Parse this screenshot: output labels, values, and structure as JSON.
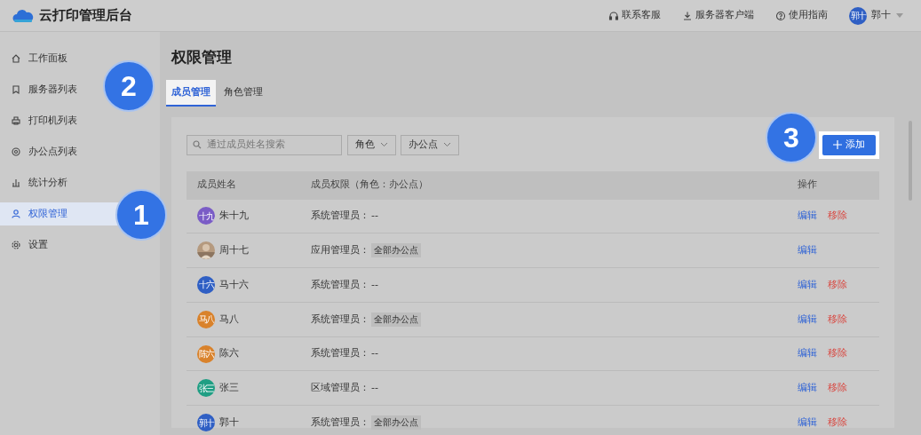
{
  "app": {
    "title": "云打印管理后台"
  },
  "top_links": [
    {
      "kind": "headset",
      "label": "联系客服"
    },
    {
      "kind": "download",
      "label": "服务器客户端"
    },
    {
      "kind": "help",
      "label": "使用指南"
    }
  ],
  "user": {
    "avatar_text": "郭十",
    "name": "郭十",
    "color": "#2f5fc4"
  },
  "sidebar": {
    "items": [
      {
        "kind": "home",
        "label": "工作面板",
        "selected": false
      },
      {
        "kind": "bookmark",
        "label": "服务器列表",
        "selected": false
      },
      {
        "kind": "printer",
        "label": "打印机列表",
        "selected": false
      },
      {
        "kind": "location",
        "label": "办公点列表",
        "selected": false
      },
      {
        "kind": "chart",
        "label": "统计分析",
        "selected": false
      },
      {
        "kind": "user",
        "label": "权限管理",
        "selected": true
      },
      {
        "kind": "gear",
        "label": "设置",
        "selected": false
      }
    ]
  },
  "page_title": "权限管理",
  "tabs": [
    {
      "label": "成员管理",
      "selected": true
    },
    {
      "label": "角色管理",
      "selected": false
    }
  ],
  "search": {
    "placeholder": "通过成员姓名搜索"
  },
  "filters": [
    "角色",
    "办公点"
  ],
  "add_button": "添加",
  "table": {
    "columns": [
      "成员姓名",
      "成员权限（角色：办公点）",
      "操作"
    ],
    "rows": [
      {
        "kind": "initials",
        "avatar_text": "十九",
        "color": "#7a5cc6",
        "name": "朱十九",
        "role": "系统管理员：",
        "scope": "--",
        "actions": [
          "编辑",
          "移除"
        ]
      },
      {
        "kind": "picture",
        "name": "周十七",
        "role": "应用管理员：",
        "scope": "全部办公点",
        "actions": [
          "编辑"
        ]
      },
      {
        "kind": "initials",
        "avatar_text": "十六",
        "color": "#2f5fc4",
        "name": "马十六",
        "role": "系统管理员：",
        "scope": "--",
        "actions": [
          "编辑",
          "移除"
        ]
      },
      {
        "kind": "initials",
        "avatar_text": "马八",
        "color": "#d9822b",
        "name": "马八",
        "role": "系统管理员：",
        "scope": "全部办公点",
        "actions": [
          "编辑",
          "移除"
        ]
      },
      {
        "kind": "initials",
        "avatar_text": "陈六",
        "color": "#d9822b",
        "name": "陈六",
        "role": "系统管理员：",
        "scope": "--",
        "actions": [
          "编辑",
          "移除"
        ]
      },
      {
        "kind": "initials",
        "avatar_text": "张三",
        "color": "#1f9e83",
        "name": "张三",
        "role": "区域管理员：",
        "scope": "--",
        "actions": [
          "编辑",
          "移除"
        ]
      },
      {
        "kind": "initials",
        "avatar_text": "郭十",
        "color": "#2f5fc4",
        "name": "郭十",
        "role": "系统管理员：",
        "scope": "全部办公点",
        "actions": [
          "编辑",
          "移除"
        ]
      }
    ]
  },
  "callouts": [
    {
      "label": "1"
    },
    {
      "label": "2"
    },
    {
      "label": "3"
    }
  ]
}
